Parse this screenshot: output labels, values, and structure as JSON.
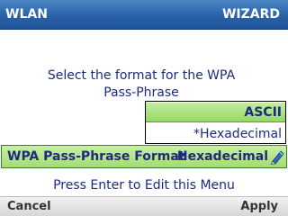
{
  "header": {
    "left": "WLAN",
    "right": "WIZARD"
  },
  "prompt": {
    "line1": "Select the format for the WPA",
    "line2": "Pass-Phrase"
  },
  "dropdown": {
    "options": [
      {
        "label": "ASCII",
        "highlighted": true
      },
      {
        "label": "*Hexadecimal",
        "highlighted": false
      }
    ]
  },
  "setting": {
    "label": "WPA Pass-Phrase Format",
    "value": "Hexadecimal",
    "icon": "pencil-icon"
  },
  "hint": "Press Enter to Edit this Menu",
  "softkeys": {
    "left": "Cancel",
    "right": "Apply"
  },
  "colors": {
    "header": "#2a62a8",
    "highlight": "#a2dd6f",
    "text": "#1c2b7e",
    "pencil": "#2d6fc4"
  }
}
